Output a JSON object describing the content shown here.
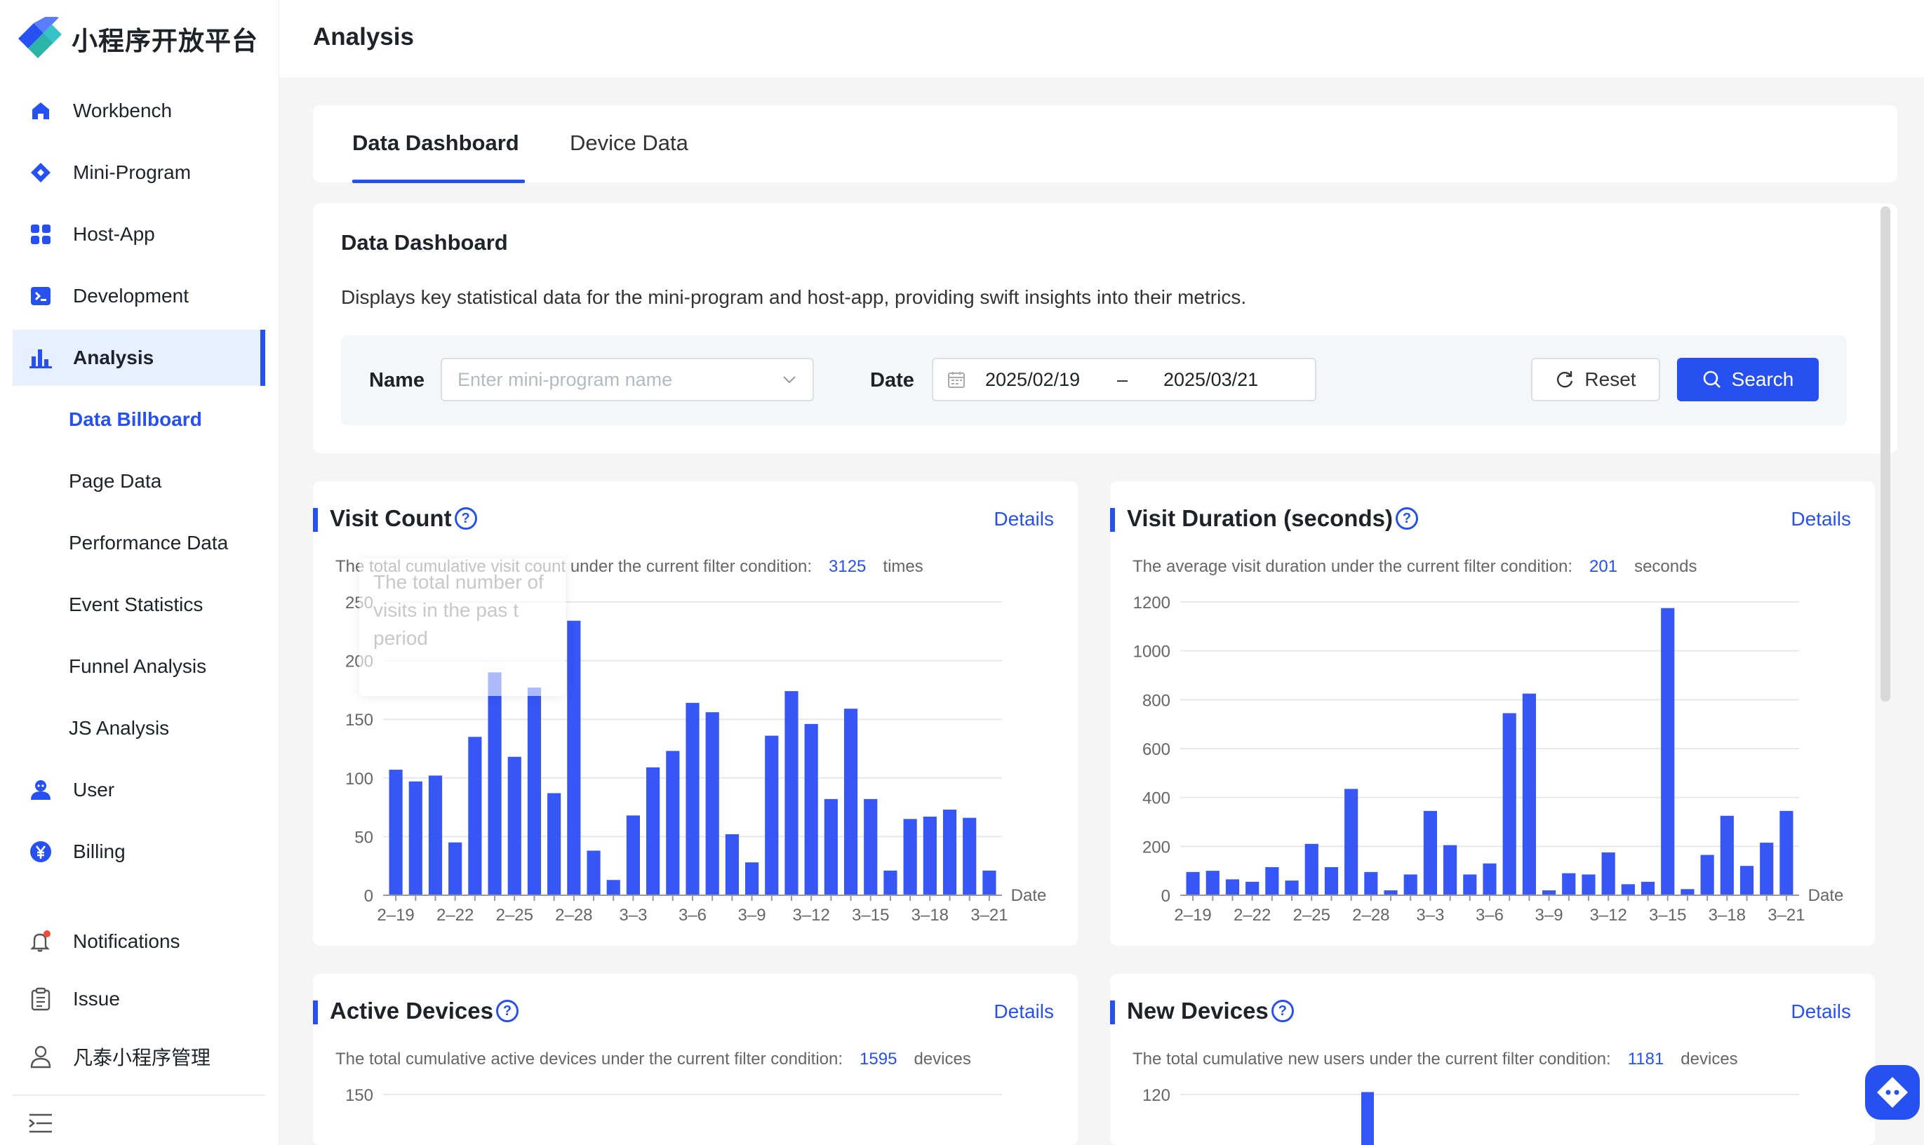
{
  "app": {
    "logo_text": "小程序开放平台",
    "page_title": "Analysis"
  },
  "sidebar": {
    "items": [
      {
        "label": "Workbench",
        "icon": "home-icon"
      },
      {
        "label": "Mini-Program",
        "icon": "diamond-icon"
      },
      {
        "label": "Host-App",
        "icon": "grid-icon"
      },
      {
        "label": "Development",
        "icon": "terminal-icon"
      },
      {
        "label": "Analysis",
        "icon": "bar-chart-icon",
        "active": true
      },
      {
        "label": "User",
        "icon": "user-icon"
      },
      {
        "label": "Billing",
        "icon": "yen-icon"
      }
    ],
    "analysis_sub": [
      "Data Billboard",
      "Page Data",
      "Performance Data",
      "Event Statistics",
      "Funnel Analysis",
      "JS Analysis"
    ],
    "bottom": [
      {
        "label": "Notifications",
        "icon": "bell-icon"
      },
      {
        "label": "Issue",
        "icon": "clipboard-icon"
      },
      {
        "label": "凡泰小程序管理",
        "icon": "person-icon"
      }
    ]
  },
  "tabs": [
    {
      "label": "Data Dashboard",
      "active": true
    },
    {
      "label": "Device Data"
    }
  ],
  "dashboard": {
    "title": "Data Dashboard",
    "description": "Displays key statistical data for the mini-program and host-app, providing swift insights into their metrics.",
    "name_label": "Name",
    "name_placeholder": "Enter mini-program name",
    "date_label": "Date",
    "date_start": "2025/02/19",
    "date_sep": "–",
    "date_end": "2025/03/21",
    "reset_label": "Reset",
    "search_label": "Search"
  },
  "cards": {
    "visit_count": {
      "title": "Visit Count",
      "details": "Details",
      "summary_prefix": "The total cumulative visit count under the current filter condition:",
      "total": "3125",
      "unit": "times",
      "tooltip": "The  total  number of visits in the pas t period"
    },
    "visit_duration": {
      "title": "Visit Duration (seconds)",
      "details": "Details",
      "summary_prefix": "The average visit duration under the current filter condition:",
      "total": "201",
      "unit": "seconds"
    },
    "active_devices": {
      "title": "Active Devices",
      "details": "Details",
      "summary_prefix": "The total cumulative active devices under the current filter condition:",
      "total": "1595",
      "unit": "devices"
    },
    "new_devices": {
      "title": "New Devices",
      "details": "Details",
      "summary_prefix": "The total cumulative new users under the current filter condition:",
      "total": "1181",
      "unit": "devices"
    }
  },
  "colors": {
    "accent": "#2750f1",
    "bar": "#3656f5"
  },
  "chart_data": [
    {
      "type": "bar",
      "title": "Visit Count",
      "xlabel": "Date",
      "ylabel": "",
      "ylim": [
        0,
        250
      ],
      "yticks": [
        0,
        50,
        100,
        150,
        200,
        250
      ],
      "x": [
        "2-19",
        "2-20",
        "2-21",
        "2-22",
        "2-23",
        "2-24",
        "2-25",
        "2-26",
        "2-27",
        "2-28",
        "3-1",
        "3-2",
        "3-3",
        "3-4",
        "3-5",
        "3-6",
        "3-7",
        "3-8",
        "3-9",
        "3-10",
        "3-11",
        "3-12",
        "3-13",
        "3-14",
        "3-15",
        "3-16",
        "3-17",
        "3-18",
        "3-19",
        "3-20",
        "3-21"
      ],
      "xtick_labels": [
        "2-19",
        "2-22",
        "2-25",
        "2-28",
        "3-3",
        "3-6",
        "3-9",
        "3-12",
        "3-15",
        "3-18",
        "3-21"
      ],
      "values": [
        107,
        97,
        102,
        45,
        135,
        190,
        118,
        177,
        87,
        234,
        38,
        13,
        68,
        109,
        123,
        164,
        156,
        52,
        28,
        136,
        174,
        146,
        82,
        159,
        82,
        21,
        65,
        67,
        73,
        66,
        21
      ]
    },
    {
      "type": "bar",
      "title": "Visit Duration (seconds)",
      "xlabel": "Date",
      "ylabel": "",
      "ylim": [
        0,
        1200
      ],
      "yticks": [
        0,
        200,
        400,
        600,
        800,
        1000,
        1200
      ],
      "x": [
        "2-19",
        "2-20",
        "2-21",
        "2-22",
        "2-23",
        "2-24",
        "2-25",
        "2-26",
        "2-27",
        "2-28",
        "3-1",
        "3-2",
        "3-3",
        "3-4",
        "3-5",
        "3-6",
        "3-7",
        "3-8",
        "3-9",
        "3-10",
        "3-11",
        "3-12",
        "3-13",
        "3-14",
        "3-15",
        "3-16",
        "3-17",
        "3-18",
        "3-19",
        "3-20",
        "3-21"
      ],
      "xtick_labels": [
        "2-19",
        "2-22",
        "2-25",
        "2-28",
        "3-3",
        "3-6",
        "3-9",
        "3-12",
        "3-15",
        "3-18",
        "3-21"
      ],
      "values": [
        95,
        100,
        65,
        55,
        115,
        60,
        210,
        115,
        435,
        95,
        20,
        85,
        345,
        205,
        85,
        130,
        745,
        825,
        20,
        90,
        85,
        175,
        45,
        55,
        1175,
        25,
        165,
        325,
        120,
        215,
        345
      ]
    },
    {
      "type": "bar",
      "title": "Active Devices",
      "ylim": [
        0,
        150
      ],
      "yticks": [
        150
      ],
      "values": []
    },
    {
      "type": "bar",
      "title": "New Devices",
      "ylim": [
        0,
        120
      ],
      "yticks": [
        120
      ],
      "values": [
        121
      ]
    }
  ]
}
